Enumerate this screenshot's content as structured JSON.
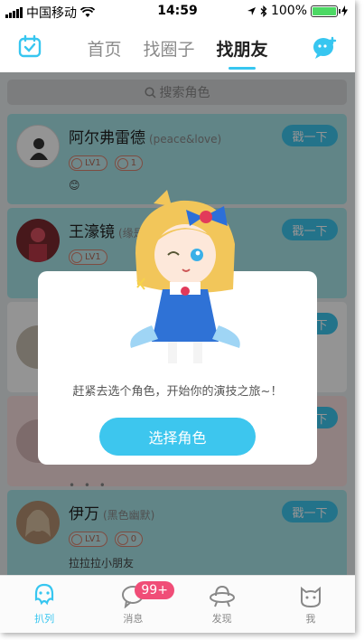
{
  "status_bar": {
    "carrier": "中国移动",
    "time": "14:59",
    "battery": "100%",
    "battery_level": 1.0
  },
  "nav": {
    "tabs": [
      {
        "label": "首页",
        "active": false
      },
      {
        "label": "找圈子",
        "active": false
      },
      {
        "label": "找朋友",
        "active": true
      }
    ],
    "left_icon": "calendar-check-icon",
    "right_icon": "chat-add-icon"
  },
  "search": {
    "placeholder": "搜索角色"
  },
  "cards": [
    {
      "name": "阿尔弗雷德",
      "tag": "(peace&love)",
      "button": "戳一下",
      "level": "LV1",
      "count": "1",
      "note": "😊"
    },
    {
      "name": "王濠镜",
      "tag": "(缘是",
      "button": "戳一下",
      "level": "LV1"
    },
    {
      "button": "戳一下"
    },
    {
      "button": "戳一下",
      "dots": "• • •"
    },
    {
      "name": "伊万",
      "tag": "(黑色幽默)",
      "button": "戳一下",
      "level": "LV1",
      "count": "0",
      "note": "拉拉拉小朋友"
    }
  ],
  "modal": {
    "message": "赶紧去选个角色，开始你的演技之旅~！",
    "button": "选择角色"
  },
  "tab_bar": {
    "items": [
      {
        "label": "扒列",
        "icon": "squid-icon",
        "active": true
      },
      {
        "label": "消息",
        "icon": "message-bubble-icon",
        "badge": "99+"
      },
      {
        "label": "发现",
        "icon": "ufo-icon"
      },
      {
        "label": "我",
        "icon": "cat-face-icon"
      }
    ]
  },
  "colors": {
    "accent": "#37c6f0",
    "badge": "#f04d77",
    "button": "#3dc6ee"
  }
}
